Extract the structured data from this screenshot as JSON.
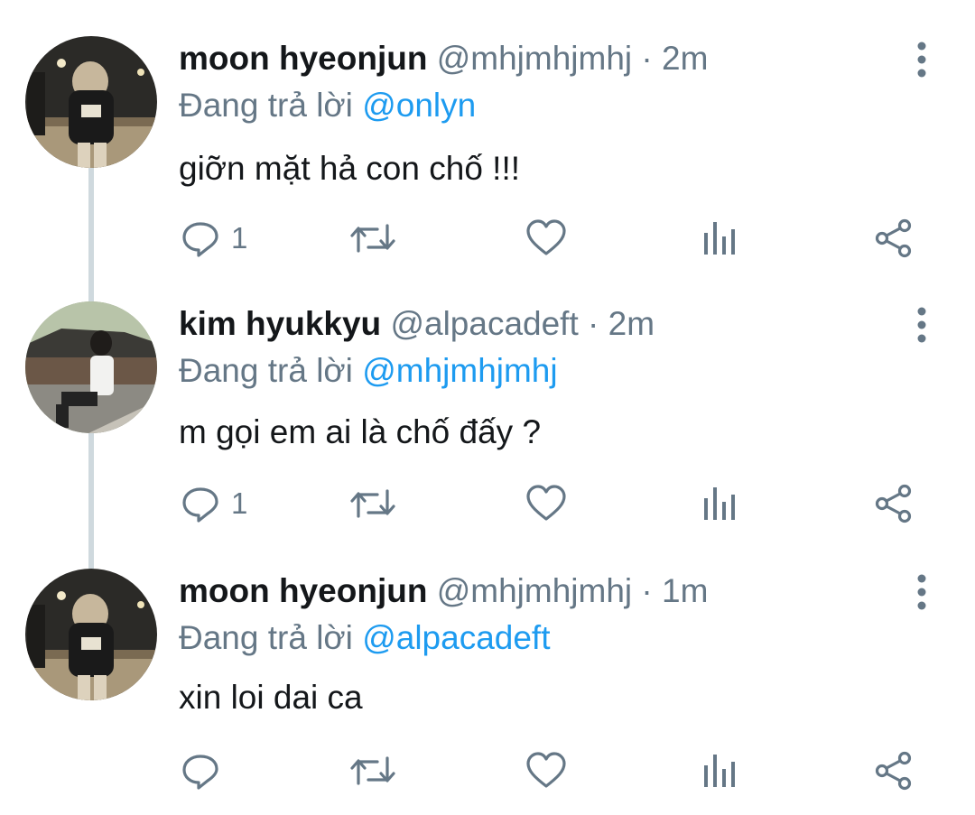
{
  "tweets": [
    {
      "name": "moon hyeonjun",
      "handle": "@mhjmhjmhj",
      "dot": "·",
      "time": "2m",
      "replying_prefix": "Đang trả lời",
      "replying_to": "@onlyn",
      "text": "giỡn mặt hả con chố !!!",
      "reply_count": "1",
      "avatar": "night-photo-avatar"
    },
    {
      "name": "kim hyukkyu",
      "handle": "@alpacadeft",
      "dot": "·",
      "time": "2m",
      "replying_prefix": "Đang trả lời",
      "replying_to": "@mhjmhjmhj",
      "text": "m gọi em ai là chố đấy ?",
      "reply_count": "1",
      "avatar": "palace-photo-avatar"
    },
    {
      "name": "moon hyeonjun",
      "handle": "@mhjmhjmhj",
      "dot": "·",
      "time": "1m",
      "replying_prefix": "Đang trả lời",
      "replying_to": "@alpacadeft",
      "text": "xin loi dai ca",
      "reply_count": "",
      "avatar": "night-photo-avatar"
    }
  ],
  "icons": {
    "reply": "reply-icon",
    "retweet": "retweet-icon",
    "like": "heart-icon",
    "stats": "analytics-icon",
    "share": "share-icon",
    "more": "more-vertical-icon"
  },
  "colors": {
    "text": "#14171a",
    "secondary": "#657786",
    "link": "#1d9bf0",
    "thread_line": "#cfd9de"
  }
}
